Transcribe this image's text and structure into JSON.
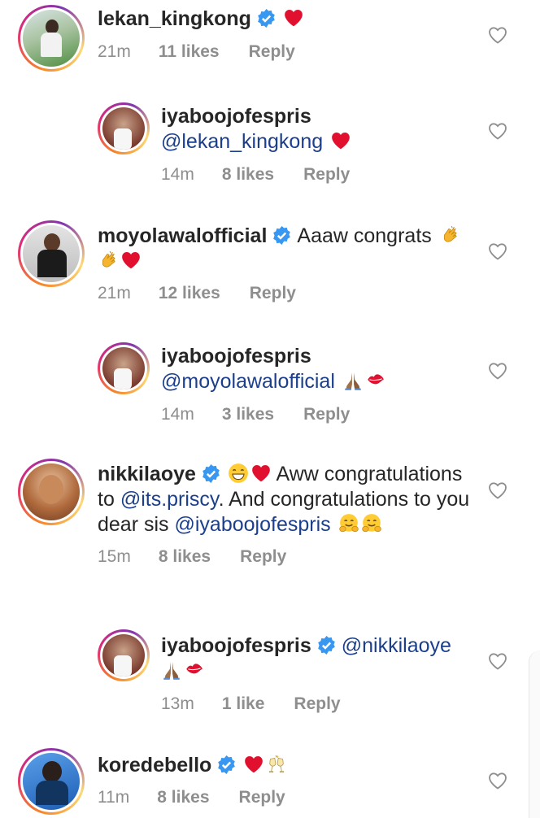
{
  "comments": [
    {
      "username": "lekan_kingkong",
      "verified": true,
      "text_before": "",
      "mention": "",
      "text_after": "",
      "emojis": [
        "red-heart"
      ],
      "time": "21m",
      "likes": "11 likes",
      "reply": "Reply",
      "avatar_color": "#6e8f5a"
    },
    {
      "username": "iyaboojofespris",
      "verified": false,
      "mention": "@lekan_kingkong",
      "emojis": [
        "red-heart"
      ],
      "time": "14m",
      "likes": "8 likes",
      "reply": "Reply",
      "avatar_color": "#7a3b2e"
    },
    {
      "username": "moyolawalofficial",
      "verified": true,
      "text": "Aaaw congrats",
      "emojis": [
        "clapping-hands",
        "clapping-hands",
        "red-heart"
      ],
      "time": "21m",
      "likes": "12 likes",
      "reply": "Reply",
      "avatar_color": "#3a3a3a"
    },
    {
      "username": "iyaboojofespris",
      "verified": false,
      "mention": "@moyolawalofficial",
      "emojis": [
        "folded-hands",
        "kiss-mark"
      ],
      "time": "14m",
      "likes": "3 likes",
      "reply": "Reply",
      "avatar_color": "#7a3b2e"
    },
    {
      "username": "nikkilaoye",
      "verified": true,
      "text_1": "Aww congratulations to",
      "mention_1": "@its.priscy",
      "text_2": ". And congratulations to you dear sis",
      "mention_2": "@iyaboojofespris",
      "emojis_lead": [
        "grinning-face",
        "red-heart"
      ],
      "emojis_trail": [
        "hugging-face",
        "hugging-face"
      ],
      "time": "15m",
      "likes": "8 likes",
      "reply": "Reply",
      "avatar_color": "#8a5a3c"
    },
    {
      "username": "iyaboojofespris",
      "verified": true,
      "mention": "@nikkilaoye",
      "emojis": [
        "folded-hands",
        "kiss-mark"
      ],
      "time": "13m",
      "likes": "1 like",
      "reply": "Reply",
      "avatar_color": "#7a3b2e"
    },
    {
      "username": "koredebello",
      "verified": true,
      "emojis": [
        "red-heart",
        "clinking-glasses"
      ],
      "time": "11m",
      "likes": "8 likes",
      "reply": "Reply",
      "avatar_color": "#2b6fc4"
    }
  ],
  "colors": {
    "username": "#262626",
    "mention": "#1c3f8c",
    "meta": "#8e8e8e",
    "verified": "#3897f0",
    "heart": "#e0102e"
  }
}
